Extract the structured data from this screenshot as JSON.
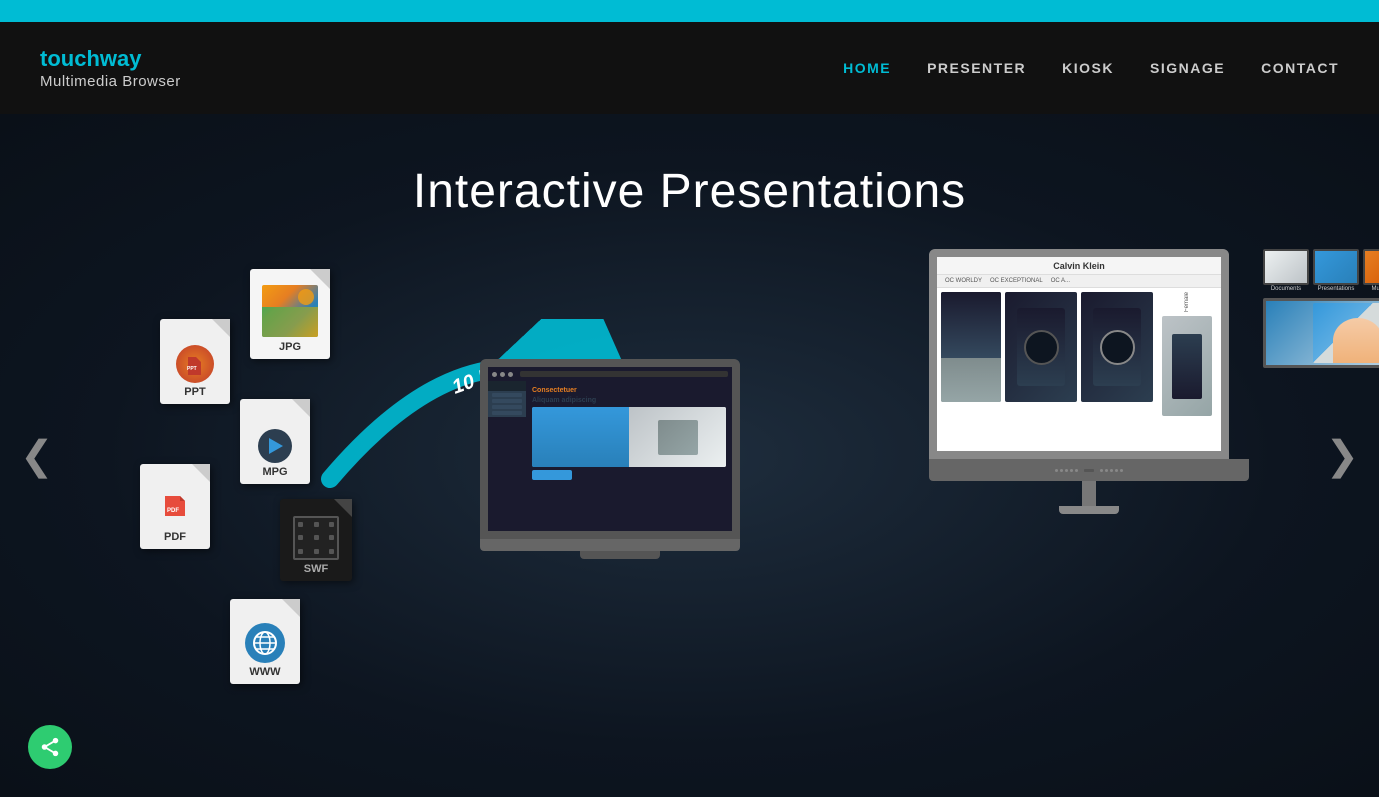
{
  "topbar": {
    "color": "#00bcd4"
  },
  "header": {
    "logo_brand_part1": "touch",
    "logo_brand_part2": "way",
    "logo_sub": "Multimedia Browser",
    "nav": {
      "home": "HOME",
      "presenter": "PRESENTER",
      "kiosk": "KIOSK",
      "signage": "SIGNAGE",
      "contact": "CONTACT"
    }
  },
  "hero": {
    "title": "Interactive Presentations",
    "arrow_label": "10 Min.",
    "nav_left": "❮",
    "nav_right": "❯",
    "files": [
      {
        "type": "ppt",
        "label": "PPT"
      },
      {
        "type": "jpg",
        "label": "JPG"
      },
      {
        "type": "mpg",
        "label": "MPG"
      },
      {
        "type": "pdf",
        "label": "PDF"
      },
      {
        "type": "swf",
        "label": "SWF"
      },
      {
        "type": "www",
        "label": "WWW"
      }
    ],
    "monitor": {
      "brand": "Calvin Klein",
      "nav_items": [
        "OC WORLDY",
        "OC EXCEPTIONAL",
        "OC A"
      ],
      "watch_label": "Female"
    },
    "laptop": {
      "title": "Consectetuer",
      "subtitle": "Aliquam adipiscing"
    }
  },
  "share": {
    "label": "share"
  }
}
